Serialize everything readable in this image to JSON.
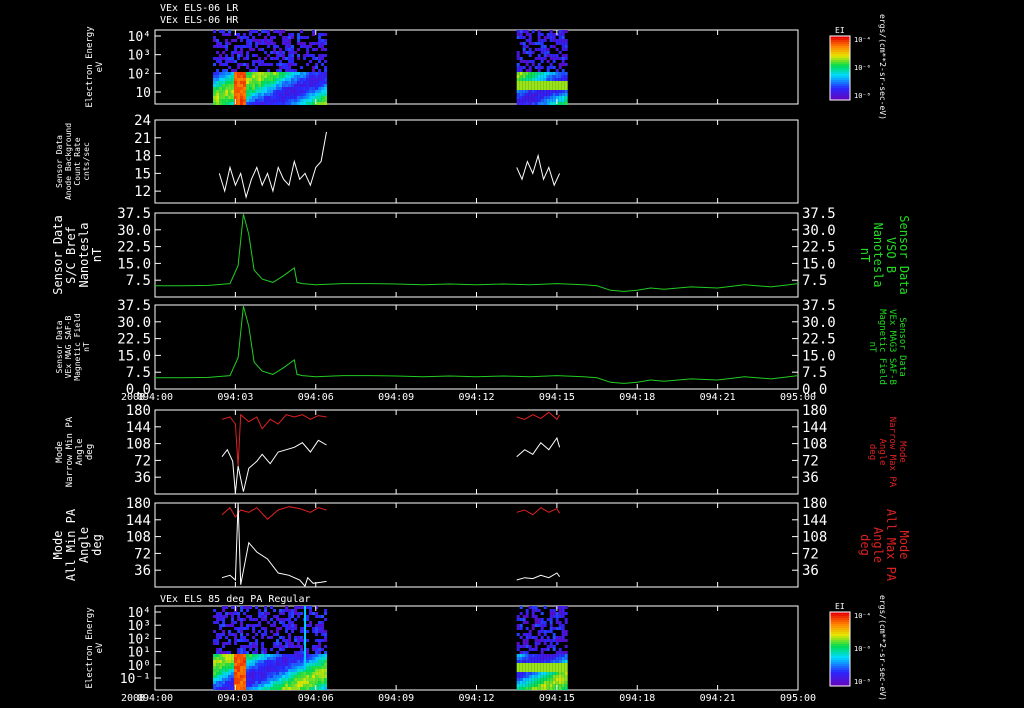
{
  "header": {
    "line1": "VEx ELS-06 LR",
    "line2": "VEx ELS-06 HR",
    "bottom_panel_title": "VEx ELS 85 deg PA Regular"
  },
  "colors": {
    "background": "#000000",
    "axes": "#ffffff",
    "magnetic": "#22cc22",
    "max_pa": "#dd2222",
    "min_pa": "#ffffff",
    "right_label_green": "#22dd22",
    "right_label_red": "#dd2222"
  },
  "colorbar": {
    "label": "EI",
    "ticks": [
      "10⁻⁴",
      "10⁻⁶",
      "10⁻⁸"
    ],
    "units": "ergs/(cm**2-sr-sec-eV)"
  },
  "x_axis": {
    "year": "2008",
    "ticks": [
      "094:00",
      "094:03",
      "094:06",
      "094:09",
      "094:12",
      "094:15",
      "094:18",
      "094:21",
      "095:00"
    ]
  },
  "chart_data": [
    {
      "type": "heatmap",
      "ylabel": [
        "Electron Energy",
        "eV"
      ],
      "yscale": "log",
      "yticks": [
        "10⁴",
        "10³",
        "10²",
        "10"
      ],
      "data_blocks": [
        {
          "x_range": [
            "094:02:10",
            "094:06:20"
          ],
          "peak_time": "094:03:10",
          "peak_energy_eV": 20
        },
        {
          "x_range": [
            "094:13:30",
            "094:15:20"
          ],
          "band_energy_eV": 10
        }
      ]
    },
    {
      "type": "line",
      "ylabel": [
        "Sensor Data",
        "Anode Background",
        "Count Rate",
        "cnts/sec"
      ],
      "ylim": [
        10,
        24
      ],
      "yticks": [
        "24",
        "21",
        "18",
        "15",
        "12"
      ],
      "series": [
        {
          "color": "#ffffff",
          "segments": [
            {
              "x_minutes": [
                2.4,
                2.6,
                2.8,
                3.0,
                3.2,
                3.4,
                3.6,
                3.8,
                4.0,
                4.2,
                4.4,
                4.6,
                4.8,
                5.0,
                5.2,
                5.4,
                5.6,
                5.8,
                6.0,
                6.2,
                6.4
              ],
              "y": [
                15,
                12,
                16,
                13,
                15,
                11,
                14,
                16,
                13,
                15,
                12,
                16,
                14,
                13,
                17,
                14,
                15,
                13,
                16,
                17,
                22
              ]
            },
            {
              "x_minutes": [
                13.5,
                13.7,
                13.9,
                14.1,
                14.3,
                14.5,
                14.7,
                14.9,
                15.1
              ],
              "y": [
                16,
                14,
                17,
                15,
                18,
                14,
                16,
                13,
                15
              ]
            }
          ]
        }
      ]
    },
    {
      "type": "line",
      "ylabel": [
        "Sensor Data",
        "S/C Bref",
        "Nanotesla",
        "nT"
      ],
      "right_label": [
        "Sensor Data",
        "VSO B",
        "Nanotesla",
        "nT"
      ],
      "ylim": [
        0,
        37.5
      ],
      "yticks": [
        "37.5",
        "30.0",
        "22.5",
        "15.0",
        "7.5"
      ],
      "series": [
        {
          "color": "#22cc22",
          "x_minutes": [
            0,
            1,
            2,
            2.8,
            3.1,
            3.3,
            3.5,
            3.7,
            4.0,
            4.4,
            4.8,
            5.2,
            5.3,
            5.5,
            6,
            7,
            8,
            9,
            10,
            11,
            12,
            13,
            14,
            15,
            16,
            16.5,
            17,
            17.5,
            18,
            18.5,
            19,
            20,
            21,
            22,
            23,
            24
          ],
          "y": [
            5,
            5,
            5.2,
            6,
            14,
            37,
            28,
            12,
            8,
            6.5,
            9.5,
            13,
            6.5,
            6,
            5.5,
            6,
            6,
            5.8,
            5.5,
            5.8,
            5.5,
            5.8,
            5.5,
            6,
            5.5,
            5,
            3,
            2.5,
            3,
            4,
            3.5,
            4.5,
            4,
            5.5,
            4.5,
            6
          ]
        }
      ]
    },
    {
      "type": "line",
      "ylabel": [
        "Sensor Data",
        "VEx MAG SAF-B",
        "Magnetic Field",
        "nT"
      ],
      "right_label": [
        "Sensor Data",
        "VEx MAG3 SAF-B",
        "Magnetic Field",
        "nT"
      ],
      "ylim": [
        0,
        37.5
      ],
      "yticks": [
        "37.5",
        "30.0",
        "22.5",
        "15.0",
        "7.5",
        "0.0"
      ],
      "series": [
        {
          "color": "#22cc22",
          "x_minutes": [
            0,
            1,
            2,
            2.8,
            3.1,
            3.3,
            3.5,
            3.7,
            4.0,
            4.4,
            4.8,
            5.2,
            5.3,
            5.5,
            6,
            7,
            8,
            9,
            10,
            11,
            12,
            13,
            14,
            15,
            16,
            16.5,
            17,
            17.5,
            18,
            18.5,
            19,
            20,
            21,
            22,
            23,
            24
          ],
          "y": [
            5,
            5,
            5.2,
            6,
            14,
            37,
            28,
            12,
            8,
            6.5,
            9.5,
            13,
            6.5,
            6,
            5.5,
            6,
            6,
            5.8,
            5.5,
            5.8,
            5.5,
            5.8,
            5.5,
            6,
            5.5,
            5,
            3,
            2.5,
            3,
            4,
            3.5,
            4.5,
            4,
            5.5,
            4.5,
            6
          ]
        }
      ]
    },
    {
      "type": "line",
      "ylabel": [
        "Mode",
        "Narrow Min PA",
        "Angle",
        "deg"
      ],
      "right_label": [
        "Mode",
        "Narrow Max PA",
        "Angle",
        "deg"
      ],
      "ylim": [
        0,
        180
      ],
      "yticks": [
        "180",
        "144",
        "108",
        "72",
        "36"
      ],
      "series": [
        {
          "color": "#dd2222",
          "segments": [
            {
              "x_minutes": [
                2.5,
                2.8,
                3.0,
                3.1,
                3.2,
                3.5,
                3.8,
                4.0,
                4.3,
                4.6,
                4.9,
                5.2,
                5.5,
                5.8,
                6.1,
                6.4
              ],
              "y": [
                160,
                165,
                150,
                60,
                170,
                155,
                165,
                140,
                160,
                150,
                170,
                165,
                170,
                160,
                168,
                165
              ]
            },
            {
              "x_minutes": [
                13.5,
                13.8,
                14.1,
                14.4,
                14.7,
                15.0,
                15.1
              ],
              "y": [
                165,
                160,
                170,
                162,
                175,
                160,
                170
              ]
            }
          ]
        },
        {
          "color": "#ffffff",
          "segments": [
            {
              "x_minutes": [
                2.5,
                2.7,
                2.9,
                3.0,
                3.1,
                3.3,
                3.5,
                3.8,
                4.0,
                4.3,
                4.6,
                4.9,
                5.2,
                5.5,
                5.8,
                6.1,
                6.4
              ],
              "y": [
                80,
                95,
                70,
                2,
                60,
                5,
                55,
                70,
                85,
                65,
                90,
                95,
                100,
                110,
                90,
                115,
                105
              ]
            },
            {
              "x_minutes": [
                13.5,
                13.8,
                14.1,
                14.4,
                14.7,
                15.0,
                15.1
              ],
              "y": [
                80,
                95,
                85,
                110,
                95,
                120,
                100
              ]
            }
          ]
        }
      ]
    },
    {
      "type": "line",
      "ylabel": [
        "Mode",
        "All Min PA",
        "Angle",
        "deg"
      ],
      "right_label": [
        "Mode",
        "All Max PA",
        "Angle",
        "deg"
      ],
      "ylim": [
        0,
        180
      ],
      "yticks": [
        "180",
        "144",
        "108",
        "72",
        "36"
      ],
      "series": [
        {
          "color": "#dd2222",
          "segments": [
            {
              "x_minutes": [
                2.5,
                2.8,
                3.0,
                3.2,
                3.5,
                3.8,
                4.2,
                4.6,
                5.0,
                5.4,
                5.8,
                6.1,
                6.4
              ],
              "y": [
                155,
                170,
                150,
                165,
                160,
                170,
                145,
                165,
                172,
                168,
                160,
                170,
                165
              ]
            },
            {
              "x_minutes": [
                13.5,
                13.8,
                14.1,
                14.4,
                14.7,
                15.0,
                15.1
              ],
              "y": [
                160,
                165,
                155,
                170,
                160,
                168,
                158
              ]
            }
          ]
        },
        {
          "color": "#ffffff",
          "segments": [
            {
              "x_minutes": [
                2.5,
                2.8,
                3.0,
                3.1,
                3.2,
                3.5,
                3.8,
                4.2,
                4.6,
                5.0,
                5.4,
                5.6,
                5.7,
                5.9,
                6.2,
                6.4
              ],
              "y": [
                20,
                25,
                15,
                180,
                5,
                95,
                75,
                60,
                30,
                25,
                15,
                2,
                20,
                8,
                10,
                12
              ]
            },
            {
              "x_minutes": [
                13.5,
                13.8,
                14.1,
                14.4,
                14.7,
                15.0,
                15.1
              ],
              "y": [
                15,
                20,
                18,
                25,
                20,
                30,
                22
              ]
            }
          ]
        }
      ]
    },
    {
      "type": "heatmap",
      "ylabel": [
        "Electron Energy",
        "eV"
      ],
      "yscale": "log",
      "yticks": [
        "10⁴",
        "10³",
        "10²",
        "10¹",
        "10⁰",
        "10⁻¹"
      ],
      "data_blocks": [
        {
          "x_range": [
            "094:02:10",
            "094:06:20"
          ],
          "peak_time": "094:03:10",
          "peak_energy_eV": 5
        },
        {
          "x_range": [
            "094:13:30",
            "094:15:20"
          ],
          "band_energy_eV": 3
        }
      ],
      "marker_line_minutes": 5.6
    }
  ]
}
